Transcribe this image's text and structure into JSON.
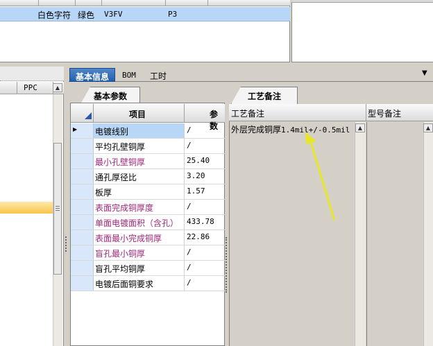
{
  "top_grid": {
    "row": {
      "c1": "白色字符",
      "c2": "绿色",
      "c3": "V3FV",
      "c4": "P3"
    }
  },
  "left_panel": {
    "column_header": "PPC"
  },
  "tabs": {
    "basic": "基本信息",
    "bom": "BOM",
    "hours": "工时"
  },
  "param_panel": {
    "subtab": "基本参数",
    "header_item": "项目",
    "header_param": "参数",
    "rows": [
      {
        "name": "电镀线别",
        "value": "/"
      },
      {
        "name": "平均孔壁铜厚",
        "value": "/"
      },
      {
        "name": "最小孔壁铜厚",
        "value": "25.40"
      },
      {
        "name": "通孔厚径比",
        "value": "3.20"
      },
      {
        "name": "板厚",
        "value": "1.57"
      },
      {
        "name": "表面完成铜厚度",
        "value": "/"
      },
      {
        "name": "单面电镀面积（含孔）",
        "value": "433.78"
      },
      {
        "name": "表面最小完成铜厚",
        "value": "22.86"
      },
      {
        "name": "盲孔最小铜厚",
        "value": "/"
      },
      {
        "name": "盲孔平均铜厚",
        "value": "/"
      },
      {
        "name": "电镀后面铜要求",
        "value": "/"
      }
    ]
  },
  "process_panel": {
    "subtab": "工艺备注",
    "col1_header": "工艺备注",
    "col2_header": "型号备注",
    "note_text": "外层完成铜厚",
    "note_mono": "1.4mil+/-0.5mil"
  },
  "colors": {
    "selected_row": "#b8d6f5",
    "active_tab": "#245fae",
    "highlight": "#f7c54a",
    "pink_label": "#a0287a",
    "arrow": "#e6e62a"
  }
}
